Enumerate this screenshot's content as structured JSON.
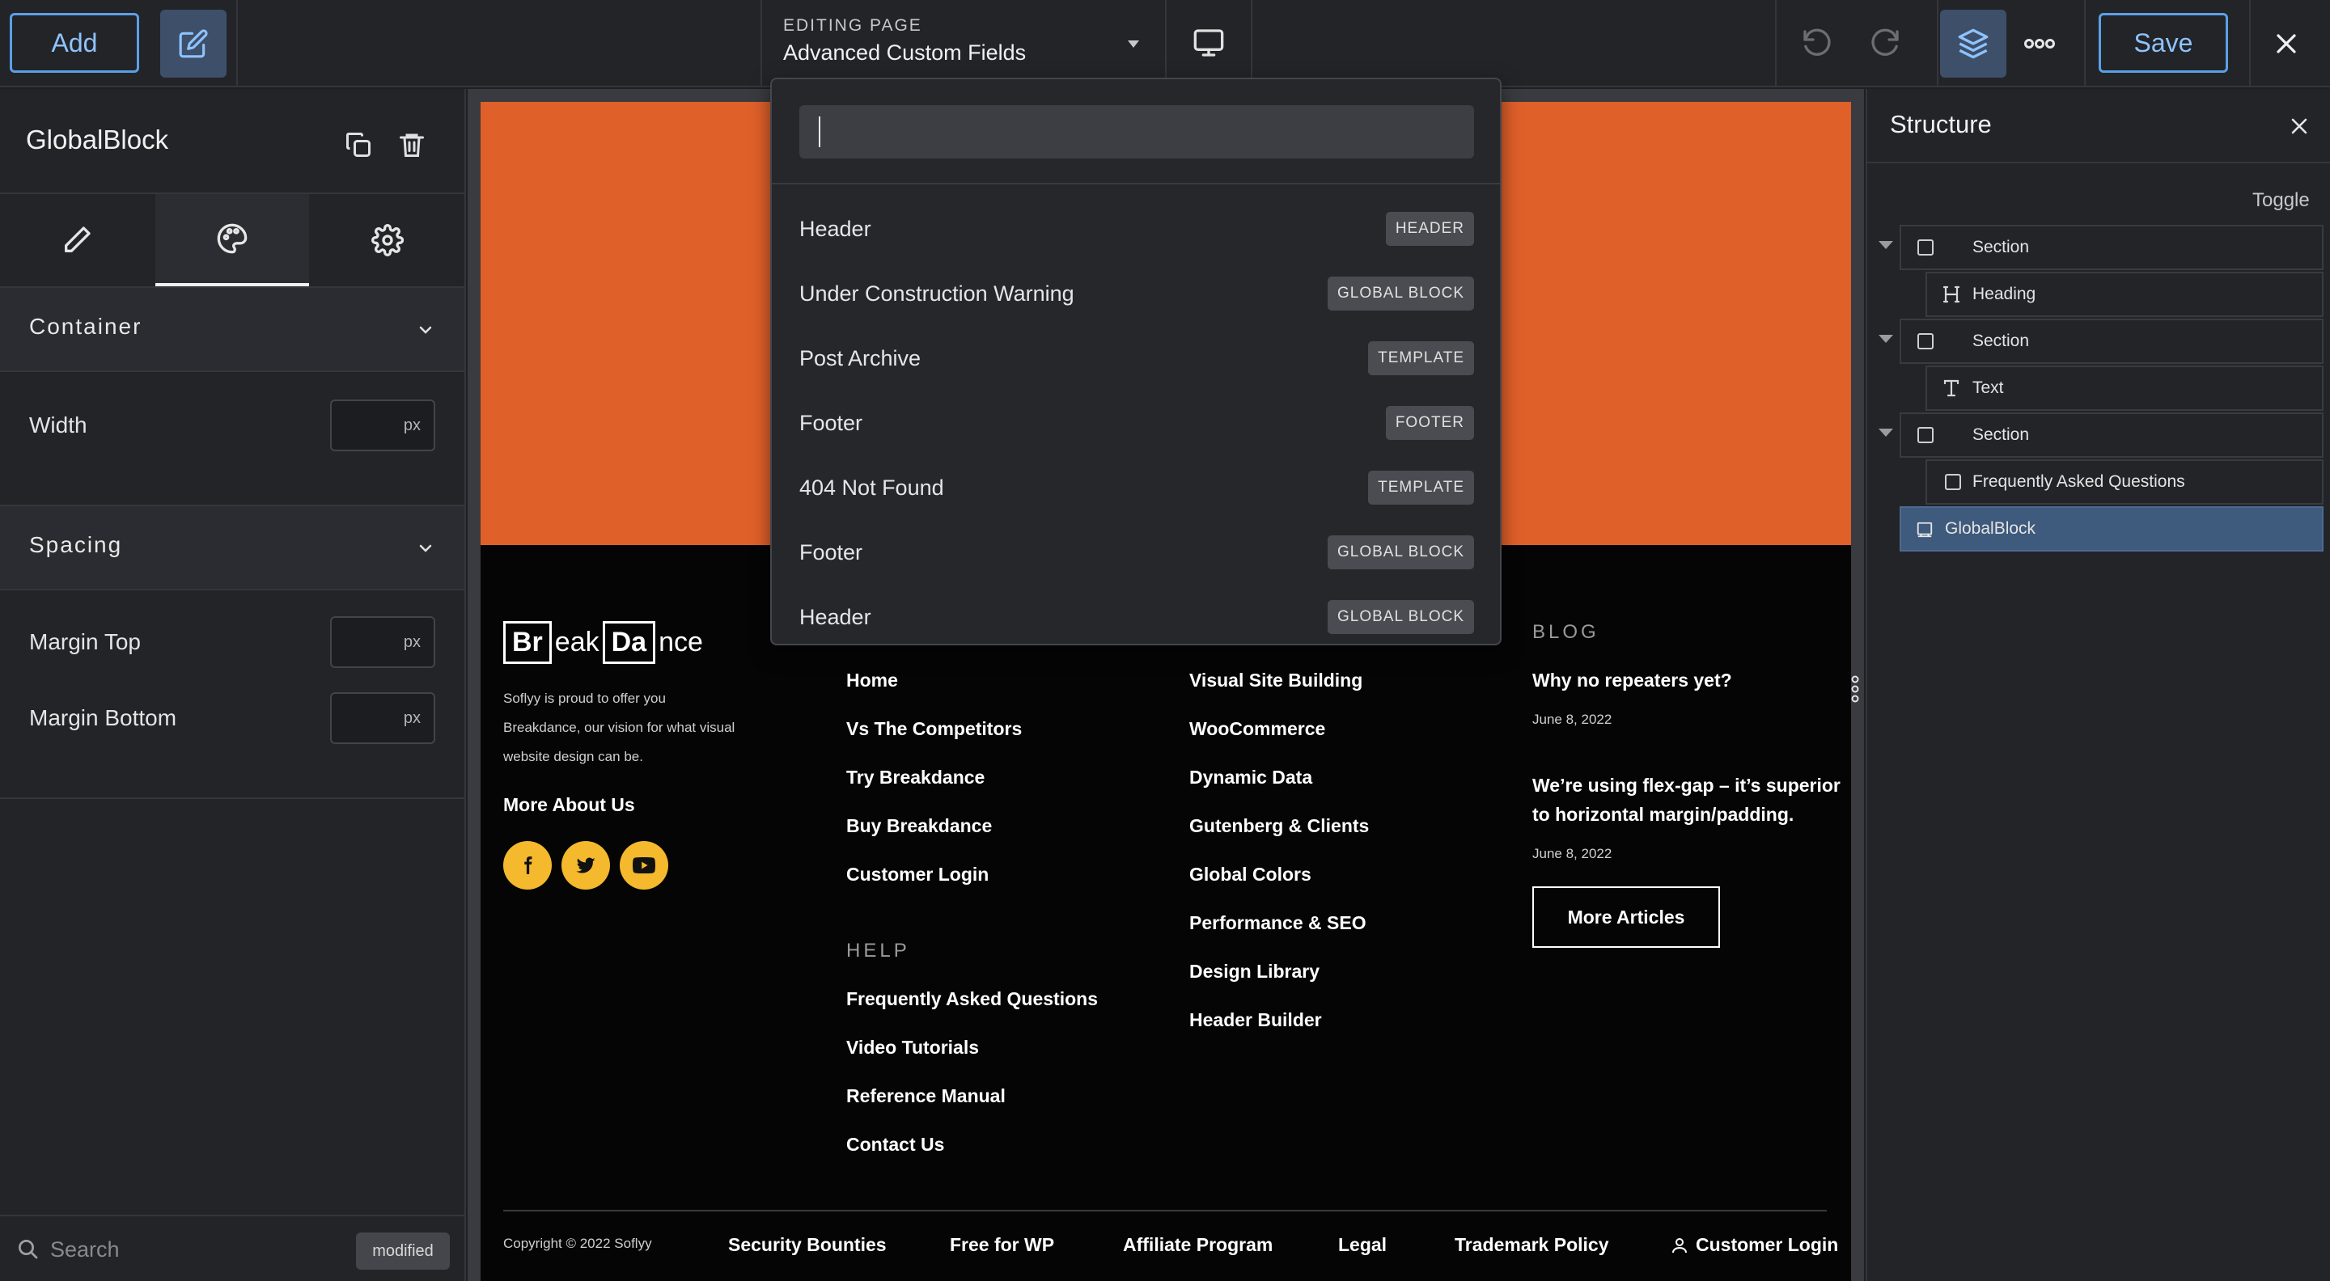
{
  "topbar": {
    "add_label": "Add",
    "editing_label": "EDITING PAGE",
    "page_name": "Advanced Custom Fields",
    "save_label": "Save",
    "icons": [
      "edit-icon",
      "chevron-down-icon",
      "desktop-icon",
      "undo-icon",
      "redo-icon",
      "layers-icon",
      "more-icon",
      "close-icon"
    ]
  },
  "left_panel": {
    "title": "GlobalBlock",
    "tabs": [
      {
        "icon": "pencil-icon"
      },
      {
        "icon": "palette-icon",
        "active": true
      },
      {
        "icon": "gear-icon"
      }
    ],
    "container": {
      "label": "Container",
      "width_label": "Width",
      "width_unit": "px"
    },
    "spacing": {
      "label": "Spacing",
      "margin_top_label": "Margin Top",
      "margin_top_unit": "px",
      "margin_bottom_label": "Margin Bottom",
      "margin_bottom_unit": "px"
    },
    "search_placeholder": "Search",
    "modified_label": "modified"
  },
  "dropdown": {
    "search_value": "",
    "items": [
      {
        "name": "Header",
        "tag": "HEADER"
      },
      {
        "name": "Under Construction Warning",
        "tag": "GLOBAL BLOCK"
      },
      {
        "name": "Post Archive",
        "tag": "TEMPLATE"
      },
      {
        "name": "Footer",
        "tag": "FOOTER"
      },
      {
        "name": "404 Not Found",
        "tag": "TEMPLATE"
      },
      {
        "name": "Footer",
        "tag": "GLOBAL BLOCK"
      },
      {
        "name": "Header",
        "tag": "GLOBAL BLOCK"
      }
    ]
  },
  "footer": {
    "logo": {
      "part1": "Br",
      "part2": "eak",
      "part3": "Da",
      "part4": "nce"
    },
    "about_line1": "Soflyy is proud to offer you",
    "about_line2": "Breakdance, our  vision for what visual",
    "about_line3": "website design can be.",
    "more_about": "More About Us",
    "col1_links": [
      "Home",
      "Vs The Competitors",
      "Try Breakdance",
      "Buy Breakdance",
      "Customer Login"
    ],
    "help_heading": "HELP",
    "help_links": [
      "Frequently Asked Questions",
      "Video Tutorials",
      "Reference Manual",
      "Contact Us"
    ],
    "col2_links": [
      "Visual Site Building",
      "WooCommerce",
      "Dynamic Data",
      "Gutenberg & Clients",
      "Global Colors",
      "Performance & SEO",
      "Design Library",
      "Header Builder"
    ],
    "blog_heading": "BLOG",
    "posts": [
      {
        "title_line1": "Why no repeaters yet?",
        "title_line2": "",
        "date": "June 8, 2022"
      },
      {
        "title_line1": "We’re using flex-gap – it’s superior",
        "title_line2": "to horizontal margin/padding.",
        "date": "June 8, 2022"
      }
    ],
    "more_articles": "More Articles",
    "copyright": "Copyright © 2022 Soflyy",
    "bottom_links": [
      "Security Bounties",
      "Free for WP",
      "Affiliate Program",
      "Legal",
      "Trademark Policy",
      "Customer Login"
    ]
  },
  "structure": {
    "title": "Structure",
    "toggle_label": "Toggle",
    "nodes": [
      {
        "label": "Section",
        "icon": "square-icon",
        "level": 0,
        "expandable": true
      },
      {
        "label": "Heading",
        "icon": "heading-icon",
        "level": 1
      },
      {
        "label": "Section",
        "icon": "square-icon",
        "level": 0,
        "expandable": true
      },
      {
        "label": "Text",
        "icon": "text-icon",
        "level": 1
      },
      {
        "label": "Section",
        "icon": "square-icon",
        "level": 0,
        "expandable": true
      },
      {
        "label": "Frequently Asked Questions",
        "icon": "square-icon",
        "level": 1
      },
      {
        "label": "GlobalBlock",
        "icon": "globalblock-icon",
        "level": 0,
        "selected": true
      }
    ]
  },
  "colors": {
    "accent": "#5aa0e8",
    "orange_section": "#e0602a",
    "social": "#f4b92c",
    "selected_row": "#3e5a7c"
  }
}
